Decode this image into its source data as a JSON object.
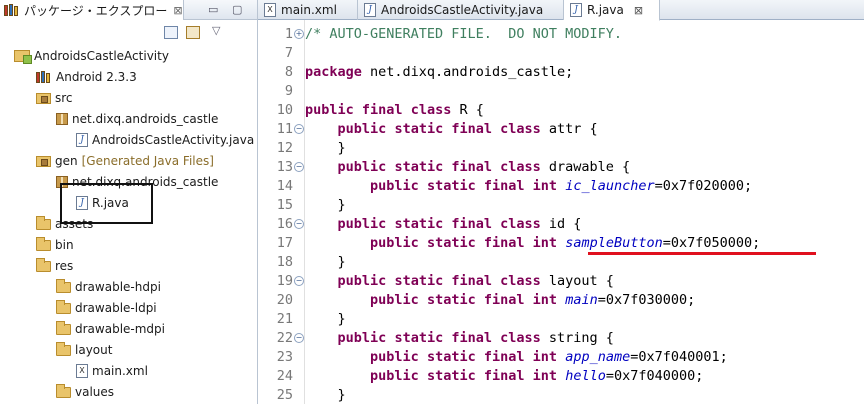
{
  "explorer": {
    "tab_title": "パッケージ・エクスプロー",
    "close_glyph": "⊠",
    "tree": [
      {
        "label": "AndroidsCastleActivity",
        "icon": "project-icon",
        "decoration": ""
      },
      {
        "label": "Android 2.3.3",
        "icon": "library-icon",
        "decoration": ""
      },
      {
        "label": "src",
        "icon": "source-folder-icon",
        "decoration": ""
      },
      {
        "label": "net.dixq.androids_castle",
        "icon": "package-icon",
        "decoration": ""
      },
      {
        "label": "AndroidsCastleActivity.java",
        "icon": "java-file-icon",
        "decoration": ""
      },
      {
        "label": "gen",
        "icon": "source-folder-icon",
        "decoration": "[Generated Java Files]"
      },
      {
        "label": "net.dixq.androids_castle",
        "icon": "package-icon",
        "decoration": ""
      },
      {
        "label": "R.java",
        "icon": "java-file-icon",
        "decoration": ""
      },
      {
        "label": "assets",
        "icon": "folder-icon",
        "decoration": ""
      },
      {
        "label": "bin",
        "icon": "folder-icon",
        "decoration": ""
      },
      {
        "label": "res",
        "icon": "folder-icon",
        "decoration": ""
      },
      {
        "label": "drawable-hdpi",
        "icon": "folder-icon",
        "decoration": ""
      },
      {
        "label": "drawable-ldpi",
        "icon": "folder-icon",
        "decoration": ""
      },
      {
        "label": "drawable-mdpi",
        "icon": "folder-icon",
        "decoration": ""
      },
      {
        "label": "layout",
        "icon": "folder-icon",
        "decoration": ""
      },
      {
        "label": "main.xml",
        "icon": "xml-file-icon",
        "decoration": ""
      },
      {
        "label": "values",
        "icon": "folder-icon",
        "decoration": ""
      }
    ]
  },
  "editor": {
    "tabs": [
      {
        "label": "main.xml",
        "icon": "xml-file-icon",
        "active": false
      },
      {
        "label": "AndroidsCastleActivity.java",
        "icon": "java-file-icon",
        "active": false
      },
      {
        "label": "R.java",
        "icon": "java-file-icon",
        "active": true
      }
    ],
    "close_glyph": "⊠",
    "lines": [
      {
        "n": "1",
        "fold": "+",
        "tokens": [
          [
            "cm",
            "/* AUTO-GENERATED FILE.  DO NOT MODIFY."
          ]
        ]
      },
      {
        "n": "7",
        "fold": "",
        "tokens": []
      },
      {
        "n": "8",
        "fold": "",
        "tokens": [
          [
            "kw",
            "package"
          ],
          [
            "tx",
            " net.dixq.androids_castle;"
          ]
        ]
      },
      {
        "n": "9",
        "fold": "",
        "tokens": []
      },
      {
        "n": "10",
        "fold": "",
        "tokens": [
          [
            "kw",
            "public"
          ],
          [
            "tx",
            " "
          ],
          [
            "kw",
            "final"
          ],
          [
            "tx",
            " "
          ],
          [
            "kw",
            "class"
          ],
          [
            "tx",
            " R {"
          ]
        ]
      },
      {
        "n": "11",
        "fold": "-",
        "tokens": [
          [
            "tx",
            "    "
          ],
          [
            "kw",
            "public"
          ],
          [
            "tx",
            " "
          ],
          [
            "kw",
            "static"
          ],
          [
            "tx",
            " "
          ],
          [
            "kw",
            "final"
          ],
          [
            "tx",
            " "
          ],
          [
            "kw",
            "class"
          ],
          [
            "tx",
            " attr {"
          ]
        ]
      },
      {
        "n": "12",
        "fold": "",
        "tokens": [
          [
            "tx",
            "    }"
          ]
        ]
      },
      {
        "n": "13",
        "fold": "-",
        "tokens": [
          [
            "tx",
            "    "
          ],
          [
            "kw",
            "public"
          ],
          [
            "tx",
            " "
          ],
          [
            "kw",
            "static"
          ],
          [
            "tx",
            " "
          ],
          [
            "kw",
            "final"
          ],
          [
            "tx",
            " "
          ],
          [
            "kw",
            "class"
          ],
          [
            "tx",
            " drawable {"
          ]
        ]
      },
      {
        "n": "14",
        "fold": "",
        "tokens": [
          [
            "tx",
            "        "
          ],
          [
            "kw",
            "public"
          ],
          [
            "tx",
            " "
          ],
          [
            "kw",
            "static"
          ],
          [
            "tx",
            " "
          ],
          [
            "kw",
            "final"
          ],
          [
            "tx",
            " "
          ],
          [
            "kw",
            "int"
          ],
          [
            "tx",
            " "
          ],
          [
            "fd",
            "ic_launcher"
          ],
          [
            "tx",
            "=0x7f020000;"
          ]
        ]
      },
      {
        "n": "15",
        "fold": "",
        "tokens": [
          [
            "tx",
            "    }"
          ]
        ]
      },
      {
        "n": "16",
        "fold": "-",
        "tokens": [
          [
            "tx",
            "    "
          ],
          [
            "kw",
            "public"
          ],
          [
            "tx",
            " "
          ],
          [
            "kw",
            "static"
          ],
          [
            "tx",
            " "
          ],
          [
            "kw",
            "final"
          ],
          [
            "tx",
            " "
          ],
          [
            "kw",
            "class"
          ],
          [
            "tx",
            " id {"
          ]
        ]
      },
      {
        "n": "17",
        "fold": "",
        "tokens": [
          [
            "tx",
            "        "
          ],
          [
            "kw",
            "public"
          ],
          [
            "tx",
            " "
          ],
          [
            "kw",
            "static"
          ],
          [
            "tx",
            " "
          ],
          [
            "kw",
            "final"
          ],
          [
            "tx",
            " "
          ],
          [
            "kw",
            "int"
          ],
          [
            "tx",
            " "
          ],
          [
            "fd",
            "sampleButton"
          ],
          [
            "tx",
            "=0x7f050000;"
          ]
        ]
      },
      {
        "n": "18",
        "fold": "",
        "tokens": [
          [
            "tx",
            "    }"
          ]
        ]
      },
      {
        "n": "19",
        "fold": "-",
        "tokens": [
          [
            "tx",
            "    "
          ],
          [
            "kw",
            "public"
          ],
          [
            "tx",
            " "
          ],
          [
            "kw",
            "static"
          ],
          [
            "tx",
            " "
          ],
          [
            "kw",
            "final"
          ],
          [
            "tx",
            " "
          ],
          [
            "kw",
            "class"
          ],
          [
            "tx",
            " layout {"
          ]
        ]
      },
      {
        "n": "20",
        "fold": "",
        "tokens": [
          [
            "tx",
            "        "
          ],
          [
            "kw",
            "public"
          ],
          [
            "tx",
            " "
          ],
          [
            "kw",
            "static"
          ],
          [
            "tx",
            " "
          ],
          [
            "kw",
            "final"
          ],
          [
            "tx",
            " "
          ],
          [
            "kw",
            "int"
          ],
          [
            "tx",
            " "
          ],
          [
            "fd",
            "main"
          ],
          [
            "tx",
            "=0x7f030000;"
          ]
        ]
      },
      {
        "n": "21",
        "fold": "",
        "tokens": [
          [
            "tx",
            "    }"
          ]
        ]
      },
      {
        "n": "22",
        "fold": "-",
        "tokens": [
          [
            "tx",
            "    "
          ],
          [
            "kw",
            "public"
          ],
          [
            "tx",
            " "
          ],
          [
            "kw",
            "static"
          ],
          [
            "tx",
            " "
          ],
          [
            "kw",
            "final"
          ],
          [
            "tx",
            " "
          ],
          [
            "kw",
            "class"
          ],
          [
            "tx",
            " string {"
          ]
        ]
      },
      {
        "n": "23",
        "fold": "",
        "tokens": [
          [
            "tx",
            "        "
          ],
          [
            "kw",
            "public"
          ],
          [
            "tx",
            " "
          ],
          [
            "kw",
            "static"
          ],
          [
            "tx",
            " "
          ],
          [
            "kw",
            "final"
          ],
          [
            "tx",
            " "
          ],
          [
            "kw",
            "int"
          ],
          [
            "tx",
            " "
          ],
          [
            "fd",
            "app_name"
          ],
          [
            "tx",
            "=0x7f040001;"
          ]
        ]
      },
      {
        "n": "24",
        "fold": "",
        "tokens": [
          [
            "tx",
            "        "
          ],
          [
            "kw",
            "public"
          ],
          [
            "tx",
            " "
          ],
          [
            "kw",
            "static"
          ],
          [
            "tx",
            " "
          ],
          [
            "kw",
            "final"
          ],
          [
            "tx",
            " "
          ],
          [
            "kw",
            "int"
          ],
          [
            "tx",
            " "
          ],
          [
            "fd",
            "hello"
          ],
          [
            "tx",
            "=0x7f040000;"
          ]
        ]
      },
      {
        "n": "25",
        "fold": "",
        "tokens": [
          [
            "tx",
            "    }"
          ]
        ]
      }
    ]
  },
  "colors": {
    "keyword": "#7f0055",
    "comment": "#3f7f5f",
    "field": "#0000c0",
    "highlight_underline": "#e0101e",
    "annotation_box": "#111111"
  }
}
